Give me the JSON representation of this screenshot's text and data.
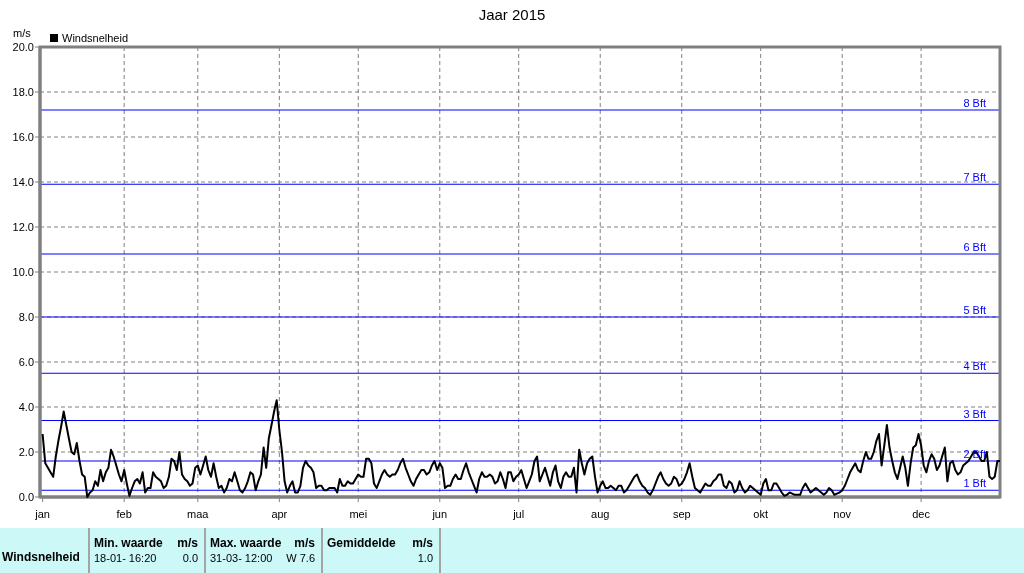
{
  "chart": {
    "chart_data": {
      "type": "line",
      "title": "Jaar 2015",
      "ylabel": "m/s",
      "grid": true,
      "categories": [
        "jan",
        null,
        null,
        null,
        null,
        null,
        null,
        null,
        null,
        null,
        null,
        null,
        null,
        null,
        null,
        null,
        null,
        null,
        null,
        null,
        null,
        null,
        null,
        null,
        null,
        null,
        null,
        null,
        null,
        null,
        null,
        "feb",
        null,
        null,
        null,
        null,
        null,
        null,
        null,
        null,
        null,
        null,
        null,
        null,
        null,
        null,
        null,
        null,
        null,
        null,
        null,
        null,
        null,
        null,
        null,
        null,
        null,
        null,
        null,
        "maa",
        null,
        null,
        null,
        null,
        null,
        null,
        null,
        null,
        null,
        null,
        null,
        null,
        null,
        null,
        null,
        null,
        null,
        null,
        null,
        null,
        null,
        null,
        null,
        null,
        null,
        null,
        null,
        null,
        null,
        null,
        "apr",
        null,
        null,
        null,
        null,
        null,
        null,
        null,
        null,
        null,
        null,
        null,
        null,
        null,
        null,
        null,
        null,
        null,
        null,
        null,
        null,
        null,
        null,
        null,
        null,
        null,
        null,
        null,
        null,
        null,
        "mei",
        null,
        null,
        null,
        null,
        null,
        null,
        null,
        null,
        null,
        null,
        null,
        null,
        null,
        null,
        null,
        null,
        null,
        null,
        null,
        null,
        null,
        null,
        null,
        null,
        null,
        null,
        null,
        null,
        null,
        null,
        "jun",
        null,
        null,
        null,
        null,
        null,
        null,
        null,
        null,
        null,
        null,
        null,
        null,
        null,
        null,
        null,
        null,
        null,
        null,
        null,
        null,
        null,
        null,
        null,
        null,
        null,
        null,
        null,
        null,
        null,
        "jul",
        null,
        null,
        null,
        null,
        null,
        null,
        null,
        null,
        null,
        null,
        null,
        null,
        null,
        null,
        null,
        null,
        null,
        null,
        null,
        null,
        null,
        null,
        null,
        null,
        null,
        null,
        null,
        null,
        null,
        null,
        "aug",
        null,
        null,
        null,
        null,
        null,
        null,
        null,
        null,
        null,
        null,
        null,
        null,
        null,
        null,
        null,
        null,
        null,
        null,
        null,
        null,
        null,
        null,
        null,
        null,
        null,
        null,
        null,
        null,
        null,
        null,
        "sep",
        null,
        null,
        null,
        null,
        null,
        null,
        null,
        null,
        null,
        null,
        null,
        null,
        null,
        null,
        null,
        null,
        null,
        null,
        null,
        null,
        null,
        null,
        null,
        null,
        null,
        null,
        null,
        null,
        null,
        "okt",
        null,
        null,
        null,
        null,
        null,
        null,
        null,
        null,
        null,
        null,
        null,
        null,
        null,
        null,
        null,
        null,
        null,
        null,
        null,
        null,
        null,
        null,
        null,
        null,
        null,
        null,
        null,
        null,
        null,
        null,
        "nov",
        null,
        null,
        null,
        null,
        null,
        null,
        null,
        null,
        null,
        null,
        null,
        null,
        null,
        null,
        null,
        null,
        null,
        null,
        null,
        null,
        null,
        null,
        null,
        null,
        null,
        null,
        null,
        null,
        null,
        "dec",
        null,
        null,
        null,
        null,
        null,
        null,
        null,
        null,
        null,
        null,
        null,
        null,
        null,
        null,
        null,
        null,
        null,
        null,
        null,
        null,
        null,
        null,
        null,
        null,
        null,
        null,
        null,
        null,
        null,
        null
      ],
      "series": [
        {
          "name": "Windsnelheid",
          "color": "#000000",
          "values": [
            2.8,
            1.5,
            1.3,
            1.1,
            0.9,
            1.8,
            2.5,
            3.1,
            3.8,
            3.2,
            2.6,
            2.0,
            1.9,
            2.4,
            1.6,
            1.0,
            0.9,
            0.0,
            0.2,
            0.3,
            0.7,
            0.5,
            1.2,
            0.7,
            1.1,
            1.3,
            2.1,
            1.8,
            1.4,
            1.0,
            0.7,
            1.2,
            0.6,
            0.05,
            0.4,
            0.7,
            0.8,
            0.6,
            1.1,
            0.2,
            0.4,
            0.4,
            1.1,
            0.9,
            0.8,
            0.7,
            0.4,
            0.5,
            0.9,
            1.7,
            1.6,
            1.2,
            2.0,
            1.0,
            0.8,
            0.7,
            0.5,
            0.6,
            1.3,
            1.4,
            1.0,
            1.4,
            1.8,
            1.2,
            0.9,
            1.5,
            0.9,
            0.4,
            0.5,
            0.2,
            0.4,
            0.8,
            0.7,
            1.1,
            0.7,
            0.3,
            0.2,
            0.4,
            0.7,
            1.1,
            1.0,
            0.3,
            0.7,
            1.0,
            2.2,
            1.3,
            2.6,
            3.2,
            3.8,
            4.3,
            3.0,
            2.0,
            0.7,
            0.2,
            0.5,
            0.7,
            0.2,
            0.2,
            0.5,
            1.3,
            1.6,
            1.4,
            1.3,
            1.1,
            0.4,
            0.5,
            0.5,
            0.3,
            0.3,
            0.4,
            0.4,
            0.4,
            0.2,
            0.8,
            0.5,
            0.5,
            0.7,
            0.6,
            0.6,
            0.8,
            1.0,
            0.9,
            0.9,
            1.7,
            1.7,
            1.5,
            0.6,
            0.4,
            0.7,
            1.0,
            1.2,
            1.0,
            0.9,
            1.0,
            1.0,
            1.2,
            1.5,
            1.7,
            1.3,
            1.0,
            0.7,
            0.5,
            0.8,
            1.0,
            1.2,
            1.2,
            1.0,
            1.1,
            1.4,
            1.6,
            1.2,
            1.5,
            1.3,
            0.4,
            0.5,
            0.5,
            0.8,
            1.0,
            0.8,
            0.8,
            1.2,
            1.5,
            1.1,
            0.8,
            0.5,
            0.2,
            0.8,
            1.1,
            0.9,
            0.9,
            1.0,
            0.9,
            0.6,
            0.7,
            1.1,
            0.8,
            0.4,
            1.1,
            1.1,
            0.7,
            0.9,
            1.0,
            1.2,
            0.8,
            0.4,
            0.7,
            1.0,
            1.6,
            1.8,
            0.7,
            1.0,
            1.3,
            0.9,
            0.5,
            1.1,
            1.4,
            0.7,
            0.4,
            0.9,
            1.1,
            0.9,
            0.9,
            1.3,
            0.2,
            2.1,
            1.5,
            1.0,
            1.5,
            1.7,
            1.8,
            0.9,
            0.2,
            0.5,
            0.7,
            0.4,
            0.4,
            0.5,
            0.4,
            0.3,
            0.5,
            0.5,
            0.2,
            0.3,
            0.5,
            0.7,
            0.9,
            1.0,
            0.7,
            0.5,
            0.4,
            0.2,
            0.1,
            0.3,
            0.6,
            0.9,
            1.1,
            0.8,
            0.6,
            0.5,
            0.6,
            0.9,
            0.8,
            0.5,
            0.6,
            0.8,
            1.1,
            1.5,
            0.9,
            0.4,
            0.3,
            0.2,
            0.4,
            0.6,
            0.5,
            0.5,
            0.7,
            0.8,
            1.0,
            1.0,
            0.5,
            0.4,
            0.7,
            0.6,
            0.2,
            0.3,
            0.7,
            0.4,
            0.2,
            0.3,
            0.5,
            0.4,
            0.3,
            0.2,
            0.1,
            0.6,
            0.8,
            0.3,
            0.3,
            0.6,
            0.6,
            0.4,
            0.2,
            0.05,
            0.1,
            0.2,
            0.15,
            0.1,
            0.1,
            0.1,
            0.4,
            0.6,
            0.4,
            0.2,
            0.3,
            0.4,
            0.3,
            0.2,
            0.1,
            0.2,
            0.4,
            0.3,
            0.1,
            0.15,
            0.2,
            0.3,
            0.5,
            0.8,
            1.1,
            1.3,
            1.5,
            1.2,
            1.1,
            1.6,
            2.0,
            1.7,
            1.7,
            2.0,
            2.5,
            2.8,
            1.4,
            2.3,
            3.2,
            2.2,
            1.6,
            1.1,
            0.8,
            1.3,
            1.8,
            1.3,
            0.5,
            1.5,
            2.2,
            2.3,
            2.8,
            2.3,
            1.4,
            1.1,
            1.6,
            1.9,
            1.7,
            1.2,
            1.4,
            1.8,
            2.2,
            0.7,
            1.5,
            1.6,
            1.2,
            1.0,
            1.1,
            1.4,
            1.5,
            1.6,
            1.8,
            2.0,
            2.0,
            1.8,
            1.6,
            1.6,
            2.0,
            0.9,
            0.8,
            0.9,
            1.6,
            1.6
          ]
        }
      ],
      "ylim": [
        0,
        20
      ],
      "yticks": [
        {
          "value": 0,
          "label": "0.0"
        },
        {
          "value": 2,
          "label": "2.0"
        },
        {
          "value": 4,
          "label": "4.0"
        },
        {
          "value": 6,
          "label": "6.0"
        },
        {
          "value": 8,
          "label": "8.0"
        },
        {
          "value": 10,
          "label": "10.0"
        },
        {
          "value": 12,
          "label": "12.0"
        },
        {
          "value": 14,
          "label": "14.0"
        },
        {
          "value": 16,
          "label": "16.0"
        },
        {
          "value": 18,
          "label": "18.0"
        },
        {
          "value": 20,
          "label": "20.0"
        }
      ],
      "ref_lines": [
        {
          "axis": "y",
          "value": 0.3,
          "label": "1 Bft"
        },
        {
          "axis": "y",
          "value": 1.6,
          "label": "2 Bft"
        },
        {
          "axis": "y",
          "value": 3.4,
          "label": "3 Bft"
        },
        {
          "axis": "y",
          "value": 5.5,
          "label": "4 Bft"
        },
        {
          "axis": "y",
          "value": 8.0,
          "label": "5 Bft"
        },
        {
          "axis": "y",
          "value": 10.8,
          "label": "6 Bft"
        },
        {
          "axis": "y",
          "value": 13.9,
          "label": "7 Bft"
        },
        {
          "axis": "y",
          "value": 17.2,
          "label": "8 Bft"
        }
      ]
    }
  },
  "stats_table": {
    "columns": [
      {
        "title": "Min. waarde",
        "unit": "m/s"
      },
      {
        "title": "Max. waarde",
        "unit": "m/s"
      },
      {
        "title": "Gemiddelde",
        "unit": "m/s"
      }
    ],
    "rows": [
      {
        "label": "Windsnelheid",
        "cells": [
          {
            "time": "18-01- 16:20",
            "value": "0.0"
          },
          {
            "time": "31-03- 12:00",
            "value": "W 7.6"
          },
          {
            "value": "1.0"
          }
        ]
      }
    ]
  }
}
